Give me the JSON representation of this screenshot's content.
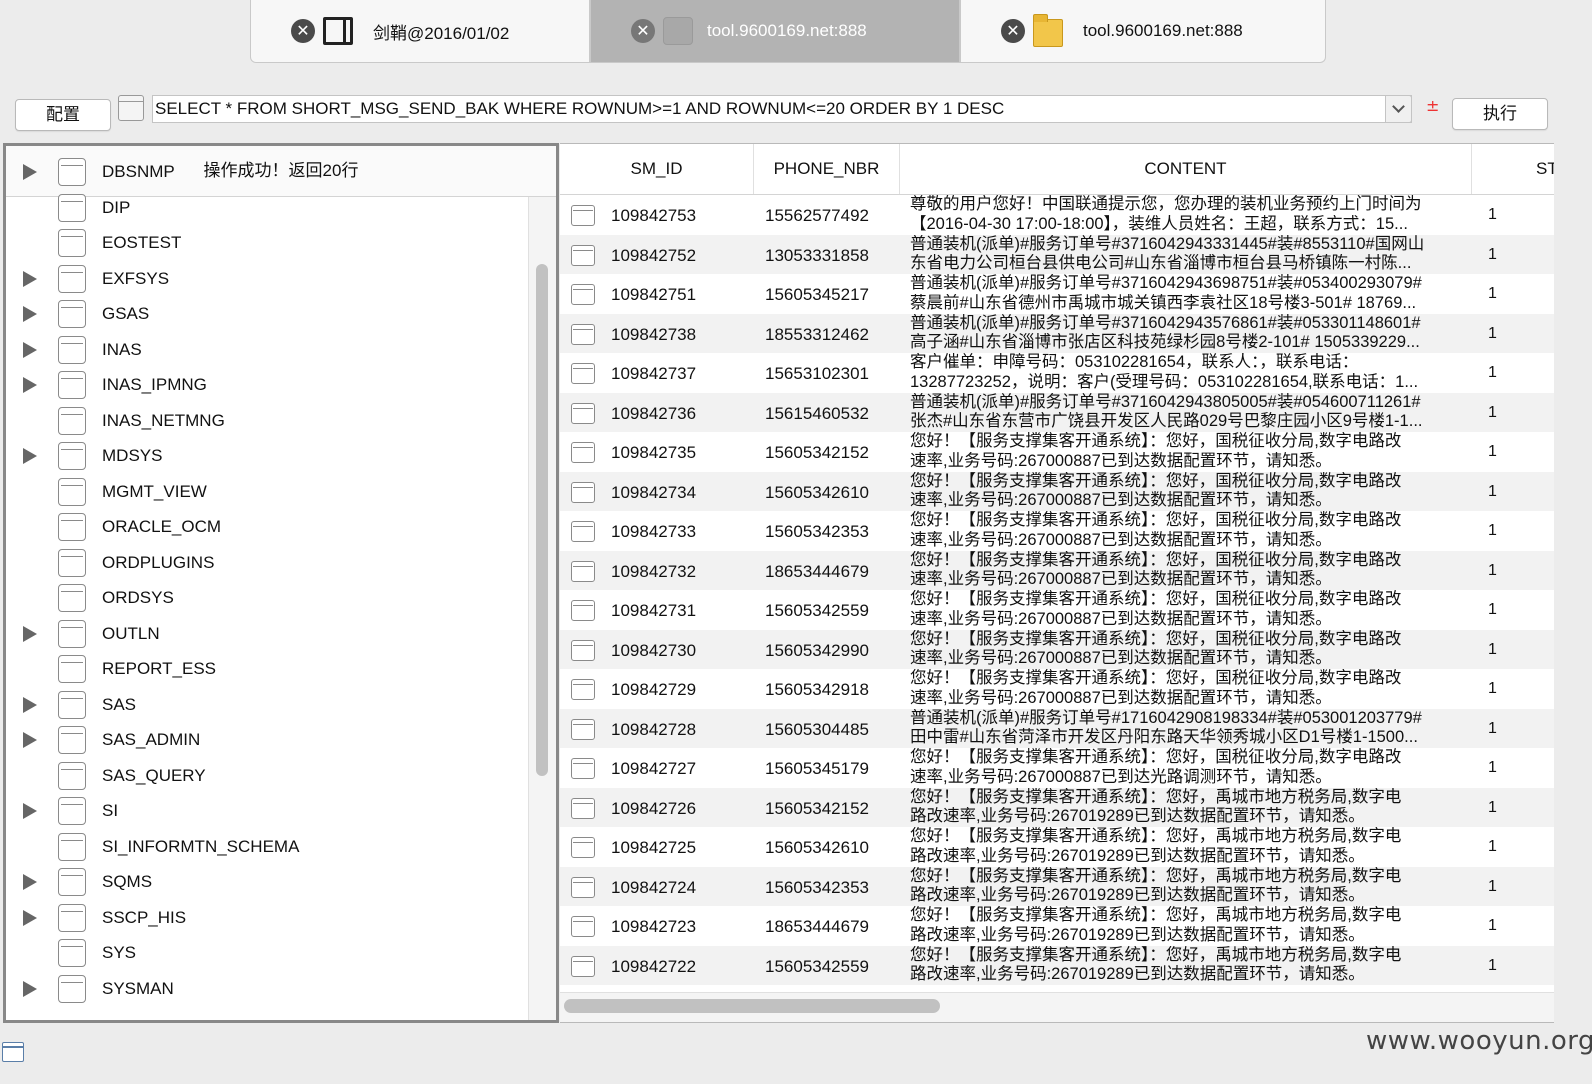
{
  "tabs": [
    {
      "label": "剑鞘@2016/01/02",
      "icon": "panel-icon",
      "active": false
    },
    {
      "label": "tool.9600169.net:888",
      "icon": "database-icon",
      "active": true
    },
    {
      "label": "tool.9600169.net:888",
      "icon": "folder-icon",
      "active": false
    }
  ],
  "tab_close_glyph": "✕",
  "toolbar": {
    "config_label": "配置",
    "sql_query": "SELECT * FROM SHORT_MSG_SEND_BAK WHERE ROWNUM>=1 AND ROWNUM<=20 ORDER BY 1 DESC",
    "plusminus": "±",
    "execute_label": "执行"
  },
  "left_panel": {
    "status": "操作成功！返回20行",
    "schemas": [
      {
        "name": "DBSNMP",
        "expandable": true
      },
      {
        "name": "DIP",
        "expandable": false
      },
      {
        "name": "EOSTEST",
        "expandable": false
      },
      {
        "name": "EXFSYS",
        "expandable": true
      },
      {
        "name": "GSAS",
        "expandable": true
      },
      {
        "name": "INAS",
        "expandable": true
      },
      {
        "name": "INAS_IPMNG",
        "expandable": true
      },
      {
        "name": "INAS_NETMNG",
        "expandable": false
      },
      {
        "name": "MDSYS",
        "expandable": true
      },
      {
        "name": "MGMT_VIEW",
        "expandable": false
      },
      {
        "name": "ORACLE_OCM",
        "expandable": false
      },
      {
        "name": "ORDPLUGINS",
        "expandable": false
      },
      {
        "name": "ORDSYS",
        "expandable": false
      },
      {
        "name": "OUTLN",
        "expandable": true
      },
      {
        "name": "REPORT_ESS",
        "expandable": false
      },
      {
        "name": "SAS",
        "expandable": true
      },
      {
        "name": "SAS_ADMIN",
        "expandable": true
      },
      {
        "name": "SAS_QUERY",
        "expandable": false
      },
      {
        "name": "SI",
        "expandable": true
      },
      {
        "name": "SI_INFORMTN_SCHEMA",
        "expandable": false
      },
      {
        "name": "SQMS",
        "expandable": true
      },
      {
        "name": "SSCP_HIS",
        "expandable": true
      },
      {
        "name": "SYS",
        "expandable": false
      },
      {
        "name": "SYSMAN",
        "expandable": true
      }
    ]
  },
  "table": {
    "columns": [
      "SM_ID",
      "PHONE_NBR",
      "CONTENT",
      "ST"
    ],
    "rows": [
      {
        "sm_id": "109842753",
        "phone": "15562577492",
        "content": [
          "尊敬的用户您好！中国联通提示您，您办理的装机业务预约上门时间为",
          "【2016-04-30 17:00-18:00】，装维人员姓名：王超，联系方式：15..."
        ],
        "st": "1"
      },
      {
        "sm_id": "109842752",
        "phone": "13053331858",
        "content": [
          "普通装机(派单)#服务订单号#371604294333144​5#装#8553110#国网山",
          "东省电力公司桓台县供电公司#山东省淄博市桓台县马桥镇陈一村陈..."
        ],
        "st": "1"
      },
      {
        "sm_id": "109842751",
        "phone": "15605345217",
        "content": [
          "普通装机(派单)#服务订单号#371604294369875​1#装#053400293079#",
          "蔡晨前#山东省德州市禹城市城关镇西李袁社区18号楼3-501# 18769..."
        ],
        "st": "1"
      },
      {
        "sm_id": "109842738",
        "phone": "18553312462",
        "content": [
          "普通装机(派单)#服务订单号#371604294357686​1#装#053301148601#",
          "高子涵#山东省淄博市张店区科技苑绿杉园8号楼2-101# 1505339229..."
        ],
        "st": "1"
      },
      {
        "sm_id": "109842737",
        "phone": "15653102301",
        "content": [
          "客户催单：申障号码：053102281654，联系人：，联系电话：",
          "13287723252，说明：客户(受理号码：053102281654,联系电话：1..."
        ],
        "st": "1"
      },
      {
        "sm_id": "109842736",
        "phone": "15615460532",
        "content": [
          "普通装机(派单)#服务订单号#371604294380500​5#装#054600711261#",
          "张杰#山东省东营市广饶县开发区人民路029号巴黎庄园小区9号楼1-1..."
        ],
        "st": "1"
      },
      {
        "sm_id": "109842735",
        "phone": "15605342152",
        "content": [
          "您好！【服务支撑集客开通系统】：您好，国税征收分局,数字电路改",
          "速率,业务号码:267000887已到达数据配置环节，请知悉。"
        ],
        "st": "1"
      },
      {
        "sm_id": "109842734",
        "phone": "15605342610",
        "content": [
          "您好！【服务支撑集客开通系统】：您好，国税征收分局,数字电路改",
          "速率,业务号码:267000887已到达数据配置环节，请知悉。"
        ],
        "st": "1"
      },
      {
        "sm_id": "109842733",
        "phone": "15605342353",
        "content": [
          "您好！【服务支撑集客开通系统】：您好，国税征收分局,数字电路改",
          "速率,业务号码:267000887已到达数据配置环节，请知悉。"
        ],
        "st": "1"
      },
      {
        "sm_id": "109842732",
        "phone": "18653444679",
        "content": [
          "您好！【服务支撑集客开通系统】：您好，国税征收分局,数字电路改",
          "速率,业务号码:267000887已到达数据配置环节，请知悉。"
        ],
        "st": "1"
      },
      {
        "sm_id": "109842731",
        "phone": "15605342559",
        "content": [
          "您好！【服务支撑集客开通系统】：您好，国税征收分局,数字电路改",
          "速率,业务号码:267000887已到达数据配置环节，请知悉。"
        ],
        "st": "1"
      },
      {
        "sm_id": "109842730",
        "phone": "15605342990",
        "content": [
          "您好！【服务支撑集客开通系统】：您好，国税征收分局,数字电路改",
          "速率,业务号码:267000887已到达数据配置环节，请知悉。"
        ],
        "st": "1"
      },
      {
        "sm_id": "109842729",
        "phone": "15605342918",
        "content": [
          "您好！【服务支撑集客开通系统】：您好，国税征收分局,数字电路改",
          "速率,业务号码:267000887已到达数据配置环节，请知悉。"
        ],
        "st": "1"
      },
      {
        "sm_id": "109842728",
        "phone": "15605304485",
        "content": [
          "普通装机(派单)#服务订单号#171604290819833​4#装#053001203779#",
          "田中雷#山东省菏泽市开发区丹阳东路天华领秀城小区D1号楼1-1500..."
        ],
        "st": "1"
      },
      {
        "sm_id": "109842727",
        "phone": "15605345179",
        "content": [
          "您好！【服务支撑集客开通系统】：您好，国税征收分局,数字电路改",
          "速率,业务号码:267000887已到达光路调测环节，请知悉。"
        ],
        "st": "1"
      },
      {
        "sm_id": "109842726",
        "phone": "15605342152",
        "content": [
          "您好！【服务支撑集客开通系统】：您好，禹城市地方税务局,数字电",
          "路改速率,业务号码:267019289已到达数据配置环节，请知悉。"
        ],
        "st": "1"
      },
      {
        "sm_id": "109842725",
        "phone": "15605342610",
        "content": [
          "您好！【服务支撑集客开通系统】：您好，禹城市地方税务局,数字电",
          "路改速率,业务号码:267019289已到达数据配置环节，请知悉。"
        ],
        "st": "1"
      },
      {
        "sm_id": "109842724",
        "phone": "15605342353",
        "content": [
          "您好！【服务支撑集客开通系统】：您好，禹城市地方税务局,数字电",
          "路改速率,业务号码:267019289已到达数据配置环节，请知悉。"
        ],
        "st": "1"
      },
      {
        "sm_id": "109842723",
        "phone": "18653444679",
        "content": [
          "您好！【服务支撑集客开通系统】：您好，禹城市地方税务局,数字电",
          "路改速率,业务号码:267019289已到达数据配置环节，请知悉。"
        ],
        "st": "1"
      },
      {
        "sm_id": "109842722",
        "phone": "15605342559",
        "content": [
          "您好！【服务支撑集客开通系统】：您好，禹城市地方税务局,数字电",
          "路改速率,业务号码:267019289已到达数据配置环节，请知悉。"
        ],
        "st": "1"
      }
    ]
  },
  "watermark": "www.wooyun.org",
  "colors": {
    "accent_red": "#e33333",
    "active_tab": "#b3b3b3"
  }
}
